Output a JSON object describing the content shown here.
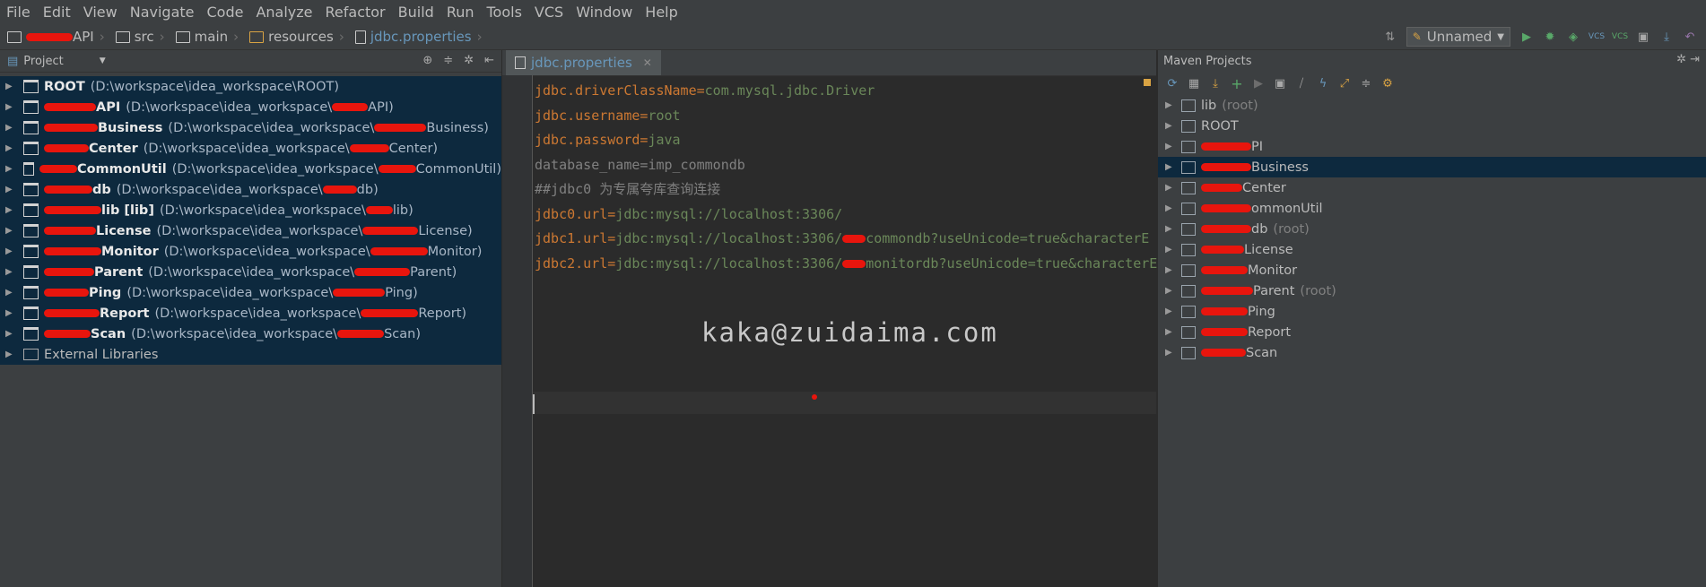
{
  "menu": [
    "File",
    "Edit",
    "View",
    "Navigate",
    "Code",
    "Analyze",
    "Refactor",
    "Build",
    "Run",
    "Tools",
    "VCS",
    "Window",
    "Help"
  ],
  "breadcrumb": {
    "project_suffix": "API",
    "items": [
      "src",
      "main",
      "resources"
    ],
    "file": "jdbc.properties"
  },
  "run_config": "Unnamed",
  "project_panel": {
    "title": "Project",
    "items": [
      {
        "name": "ROOT",
        "path": "(D:\\workspace\\idea_workspace\\ROOT)"
      },
      {
        "name": "API",
        "path": "(D:\\workspace\\idea_workspace\\",
        "path_end": "API)"
      },
      {
        "name": "Business",
        "path": "(D:\\workspace\\idea_workspace\\",
        "path_end": "Business)"
      },
      {
        "name": "Center",
        "path": "(D:\\workspace\\idea_workspace\\",
        "path_end": "Center)"
      },
      {
        "name": "CommonUtil",
        "path": "(D:\\workspace\\idea_workspace\\",
        "path_end": "CommonUtil)"
      },
      {
        "name": "db",
        "path": "(D:\\workspace\\idea_workspace\\",
        "path_end": "db)"
      },
      {
        "name": "lib [lib]",
        "path": "(D:\\workspace\\idea_workspace\\",
        "path_end": "lib)"
      },
      {
        "name": "License",
        "path": "(D:\\workspace\\idea_workspace\\",
        "path_end": "License)"
      },
      {
        "name": "Monitor",
        "path": "(D:\\workspace\\idea_workspace\\",
        "path_end": "Monitor)"
      },
      {
        "name": "Parent",
        "path": "(D:\\workspace\\idea_workspace\\",
        "path_end": "Parent)"
      },
      {
        "name": "Ping",
        "path": "(D:\\workspace\\idea_workspace\\",
        "path_end": "Ping)"
      },
      {
        "name": "Report",
        "path": "(D:\\workspace\\idea_workspace\\",
        "path_end": "Report)"
      },
      {
        "name": "Scan",
        "path": "(D:\\workspace\\idea_workspace\\",
        "path_end": "Scan)"
      },
      {
        "name": "External Libraries",
        "path": ""
      }
    ]
  },
  "editor": {
    "tab": "jdbc.properties",
    "lines": [
      {
        "key": "jdbc.driverClassName",
        "val": "com.mysql.jdbc.Driver"
      },
      {
        "key": "jdbc.username",
        "val": "root"
      },
      {
        "key": "jdbc.password",
        "val": "java"
      },
      {
        "key": "database_name",
        "val": "imp_commondb",
        "dim": true
      },
      {
        "comment": "##jdbc0 为专属夸库查询连接"
      },
      {
        "key": "jdbc0.url",
        "val": "jdbc:mysql://localhost:3306/"
      },
      {
        "key": "jdbc1.url",
        "val": "jdbc:mysql://localhost:3306/",
        "val_end": "commondb?useUnicode=true&characterE"
      },
      {
        "key": "jdbc2.url",
        "val": "jdbc:mysql://localhost:3306/",
        "val_end": "monitordb?useUnicode=true&characterE"
      }
    ],
    "watermark": "kaka@zuidaima.com"
  },
  "maven": {
    "title": "Maven Projects",
    "items": [
      {
        "name": "lib",
        "suffix": "(root)"
      },
      {
        "name": "ROOT",
        "suffix": ""
      },
      {
        "name": "PI",
        "suffix": ""
      },
      {
        "name": "Business",
        "suffix": "",
        "selected": true
      },
      {
        "name": "Center",
        "suffix": ""
      },
      {
        "name": "ommonUtil",
        "suffix": ""
      },
      {
        "name": "db",
        "suffix": "(root)"
      },
      {
        "name": "License",
        "suffix": ""
      },
      {
        "name": "Monitor",
        "suffix": ""
      },
      {
        "name": "Parent",
        "suffix": "(root)"
      },
      {
        "name": "Ping",
        "suffix": ""
      },
      {
        "name": "Report",
        "suffix": ""
      },
      {
        "name": "Scan",
        "suffix": ""
      }
    ]
  }
}
